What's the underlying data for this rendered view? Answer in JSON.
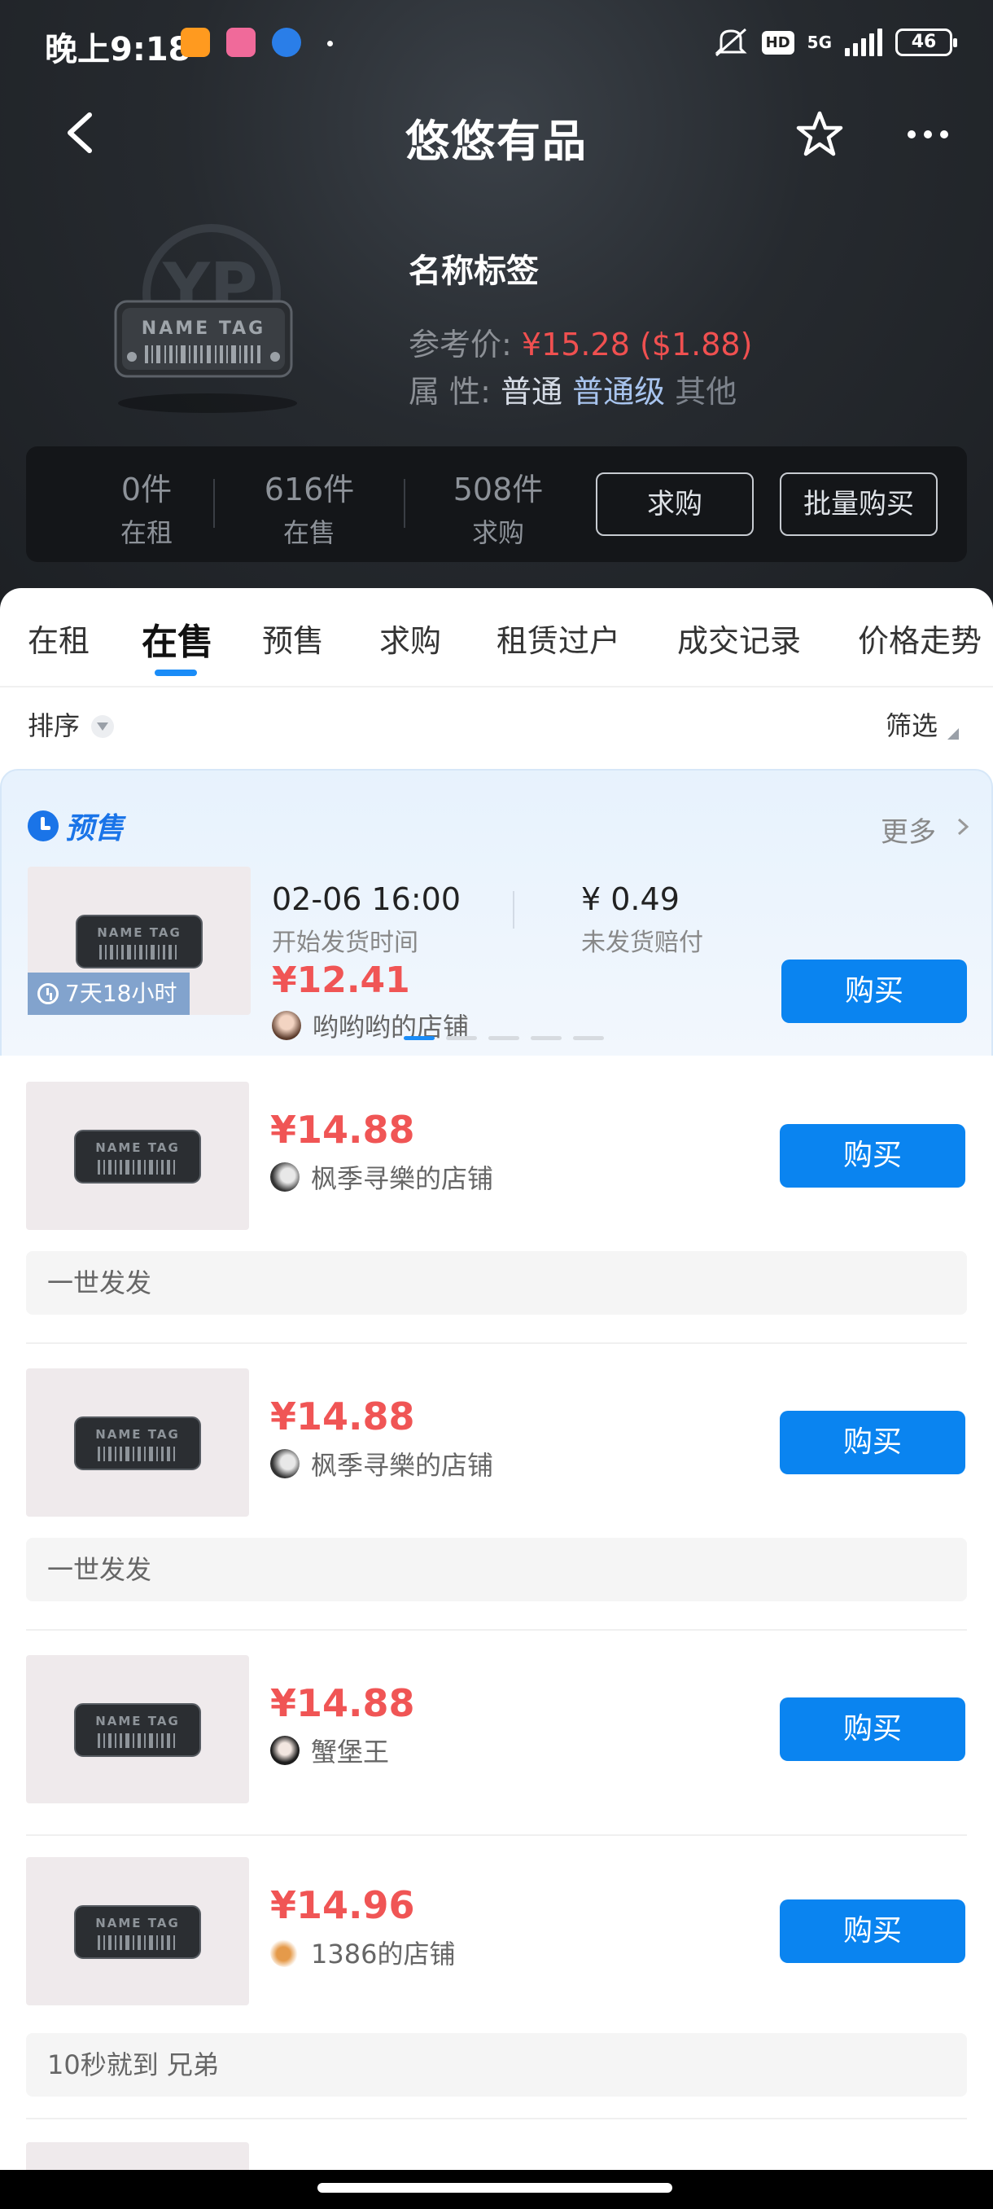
{
  "status_bar": {
    "time": "晚上9:18",
    "battery": "46",
    "network": "5G",
    "hd": "HD"
  },
  "nav": {
    "title": "悠悠有品"
  },
  "product": {
    "name": "名称标签",
    "ref_price_label": "参考价:",
    "ref_price_value": "¥15.28",
    "ref_price_usd": "($1.88)",
    "attr_label": "属 性:",
    "attrs": [
      "普通",
      "普通级",
      "其他"
    ],
    "image_text": "NAME TAG"
  },
  "stats": [
    {
      "num": "0件",
      "label": "在租"
    },
    {
      "num": "616件",
      "label": "在售"
    },
    {
      "num": "508件",
      "label": "求购"
    }
  ],
  "stat_buttons": {
    "buy_request": "求购",
    "bulk_buy": "批量购买"
  },
  "tabs": [
    "在租",
    "在售",
    "预售",
    "求购",
    "租赁过户",
    "成交记录",
    "价格走势"
  ],
  "active_tab": "在售",
  "sortbar": {
    "sort_label": "排序",
    "filter_label": "筛选"
  },
  "presale": {
    "badge": "预售",
    "more": "更多",
    "date": "02-06 16:00",
    "date_label": "开始发货时间",
    "compensation": "¥ 0.49",
    "compensation_label": "未发货赔付",
    "price": "¥12.41",
    "shop": "哟哟哟的店铺",
    "countdown": "7天18小时",
    "buy": "购买",
    "page_dots": 5,
    "active_dot": 0
  },
  "listings": [
    {
      "price": "¥14.88",
      "shop": "枫季寻樂的店铺",
      "note": "一世发发",
      "buy": "购买"
    },
    {
      "price": "¥14.88",
      "shop": "枫季寻樂的店铺",
      "note": "一世发发",
      "buy": "购买"
    },
    {
      "price": "¥14.88",
      "shop": "蟹堡王",
      "note": "",
      "buy": "购买"
    },
    {
      "price": "¥14.96",
      "shop": "1386的店铺",
      "note": "10秒就到 兄弟",
      "buy": "购买"
    }
  ],
  "colors": {
    "accent": "#0a84f0",
    "price_red": "#f05555",
    "header_bg": "#262a2f"
  }
}
